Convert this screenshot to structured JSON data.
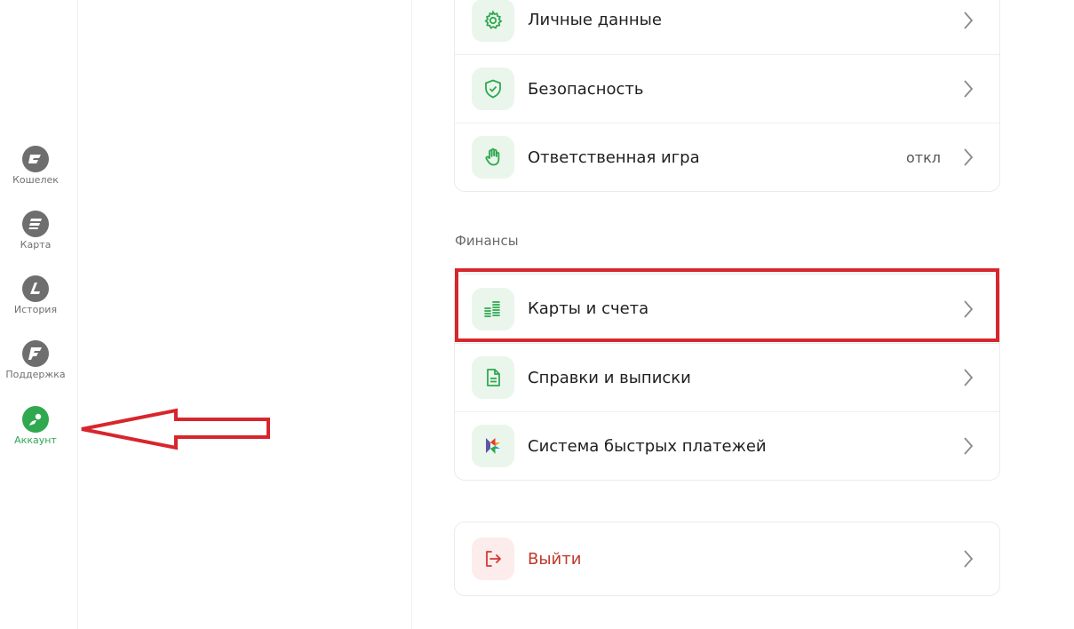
{
  "nav": {
    "items": [
      {
        "label": "Кошелек",
        "icon": "wallet-icon"
      },
      {
        "label": "Карта",
        "icon": "map-icon"
      },
      {
        "label": "История",
        "icon": "history-icon"
      },
      {
        "label": "Поддержка",
        "icon": "support-icon"
      },
      {
        "label": "Аккаунт",
        "icon": "account-icon",
        "active": true
      }
    ]
  },
  "account": {
    "items": [
      {
        "title": "Личные данные",
        "icon": "gear-icon"
      },
      {
        "title": "Безопасность",
        "icon": "shield-icon"
      },
      {
        "title": "Ответственная игра",
        "value": "откл",
        "icon": "hand-icon"
      }
    ]
  },
  "finance": {
    "section_title": "Финансы",
    "items": [
      {
        "title": "Карты и счета",
        "icon": "coins-icon"
      },
      {
        "title": "Справки и выписки",
        "icon": "document-icon"
      },
      {
        "title": "Система быстрых платежей",
        "icon": "sbp-icon"
      }
    ]
  },
  "logout": {
    "title": "Выйти",
    "icon": "logout-icon"
  },
  "colors": {
    "accent": "#2fa84f",
    "highlight": "#d7262c",
    "danger": "#c0392b"
  }
}
